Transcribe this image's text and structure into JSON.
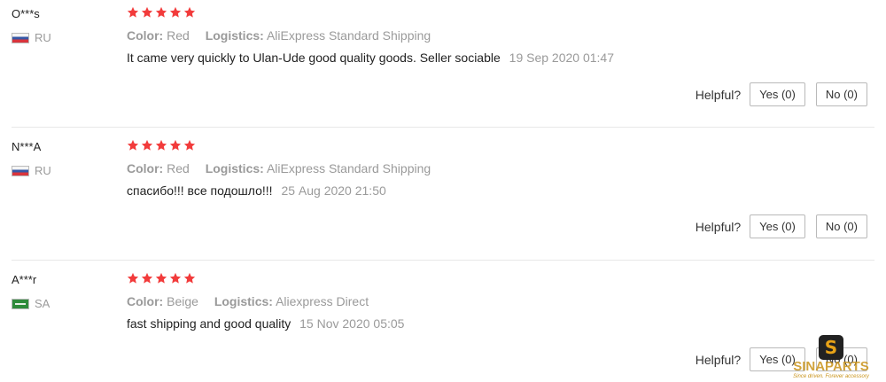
{
  "reviews": [
    {
      "user": "O***s",
      "country": "RU",
      "rating": 5,
      "color_label": "Color:",
      "color_value": "Red",
      "logistics_label": "Logistics:",
      "logistics_value": "AliExpress Standard Shipping",
      "text": "It came very quickly to Ulan-Ude good quality goods. Seller sociable",
      "date": "19 Sep 2020 01:47",
      "helpful_label": "Helpful?",
      "yes_label": "Yes (0)",
      "no_label": "No (0)"
    },
    {
      "user": "N***A",
      "country": "RU",
      "rating": 5,
      "color_label": "Color:",
      "color_value": "Red",
      "logistics_label": "Logistics:",
      "logistics_value": "AliExpress Standard Shipping",
      "text": "спасибо!!! все подошло!!!",
      "date": "25 Aug 2020 21:50",
      "helpful_label": "Helpful?",
      "yes_label": "Yes (0)",
      "no_label": "No (0)"
    },
    {
      "user": "A***r",
      "country": "SA",
      "rating": 5,
      "color_label": "Color:",
      "color_value": "Beige",
      "logistics_label": "Logistics:",
      "logistics_value": "Aliexpress Direct",
      "text": "fast shipping and good quality",
      "date": "15 Nov 2020 05:05",
      "helpful_label": "Helpful?",
      "yes_label": "Yes (0)",
      "no_label": "No (0)"
    }
  ],
  "watermark": {
    "badge": "S",
    "name": "SINAPARTS",
    "tagline": "Since driven. Forever accessory"
  },
  "colors": {
    "star": "#f23b3b",
    "muted_text": "#9a9a9a",
    "divider": "#e8e8e8",
    "watermark": "#c9931a"
  }
}
